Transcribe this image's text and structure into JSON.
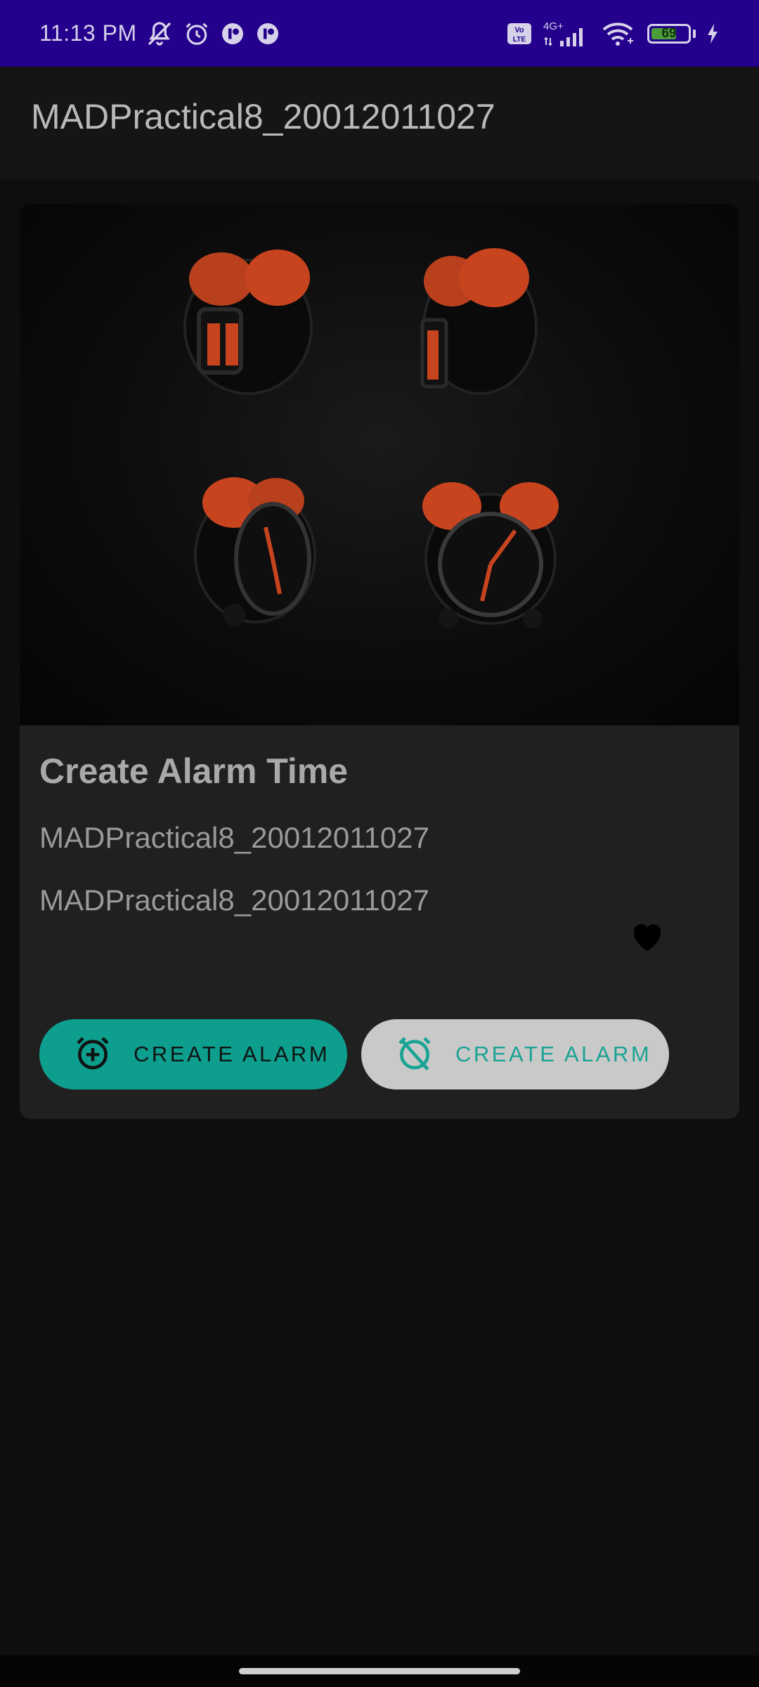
{
  "status_bar": {
    "time": "11:13 PM",
    "network_label_top": "4G+",
    "volte_label": "Vo LTE",
    "battery_level": 69,
    "battery_text": "69",
    "icons_left": [
      "silent-bell-icon",
      "alarm-icon",
      "notification-app-icon",
      "notification-app-icon"
    ],
    "icons_right": [
      "volte-icon",
      "signal-icon",
      "wifi-icon",
      "battery-icon",
      "charging-icon"
    ]
  },
  "app_bar": {
    "title": "MADPractical8_20012011027"
  },
  "card": {
    "image_description_icon": "alarm-clocks-image",
    "headline": "Create Alarm Time",
    "subtitle_1": "MADPractical8_20012011027",
    "subtitle_2": "MADPractical8_20012011027",
    "favorite_icon": "heart-icon",
    "buttons": [
      {
        "label": "CREATE ALARM",
        "icon": "alarm-add-icon",
        "style": "filled"
      },
      {
        "label": "CREATE ALARM",
        "icon": "alarm-off-icon",
        "style": "tonal"
      }
    ]
  },
  "colors": {
    "status_bar": "#24008c",
    "primary_button": "#0d9e8e",
    "secondary_button": "#c9c9c9",
    "accent_text": "#19a394",
    "bell_orange": "#c8441f"
  }
}
